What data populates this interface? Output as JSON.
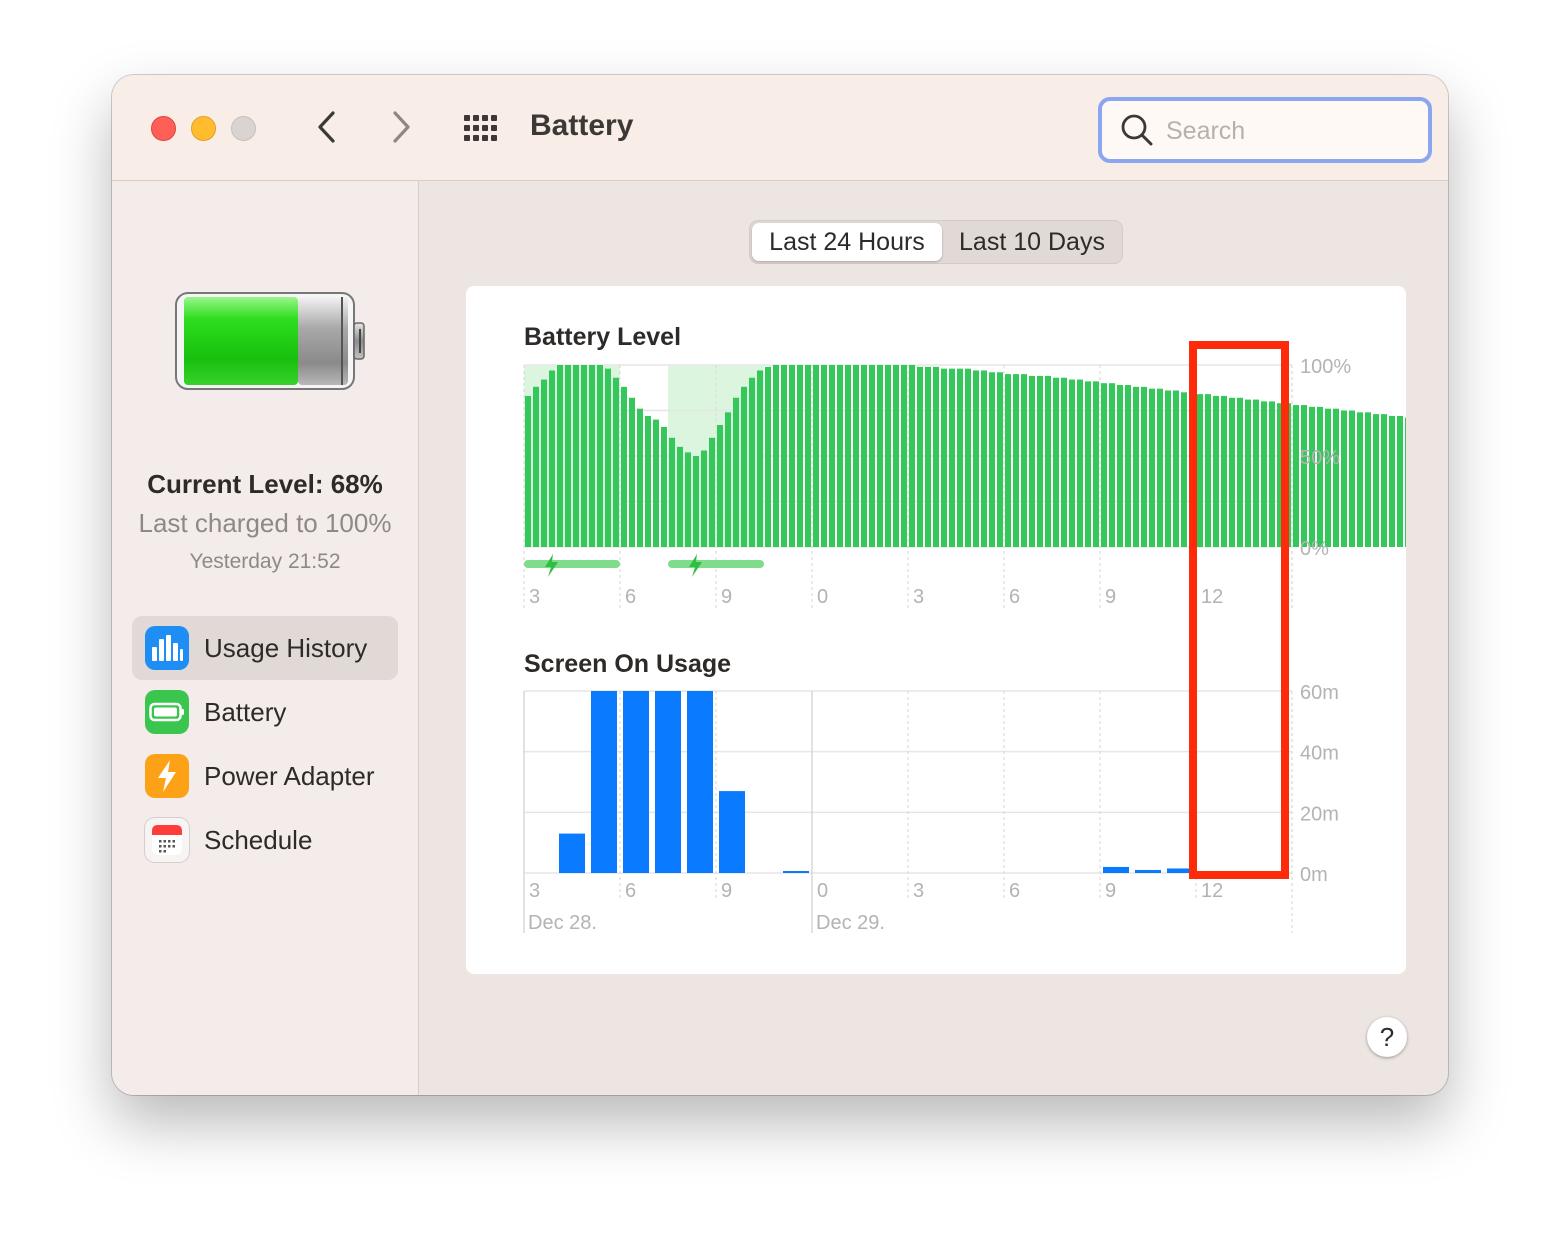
{
  "window": {
    "title": "Battery",
    "search": {
      "placeholder": "Search",
      "value": ""
    }
  },
  "sidebar": {
    "current_level": "Current Level: 68%",
    "last_charged": "Last charged to 100%",
    "charge_time": "Yesterday 21:52",
    "items": [
      {
        "label": "Usage History",
        "icon": "bar-chart-icon",
        "selected": true
      },
      {
        "label": "Battery",
        "icon": "battery-icon",
        "selected": false
      },
      {
        "label": "Power Adapter",
        "icon": "lightning-icon",
        "selected": false
      },
      {
        "label": "Schedule",
        "icon": "calendar-icon",
        "selected": false
      }
    ]
  },
  "main": {
    "segments": [
      {
        "label": "Last 24 Hours",
        "selected": true
      },
      {
        "label": "Last 10 Days",
        "selected": false
      }
    ],
    "help_label": "?"
  },
  "colors": {
    "battery_bar": "#34c759",
    "charging_band": "#dcf5de",
    "screen_bar": "#0a7aff",
    "highlight_box": "#ff2a0a"
  },
  "chart_data": [
    {
      "type": "bar",
      "title": "Battery Level",
      "x_tick_labels": [
        "3",
        "6",
        "9",
        "0",
        "3",
        "6",
        "9",
        "12"
      ],
      "y_tick_labels": [
        "100%",
        "50%",
        "0%"
      ],
      "ylim": [
        0,
        100
      ],
      "interval_hours": 0.25,
      "start_hour": 3,
      "values": [
        83,
        88,
        92,
        97,
        100,
        100,
        100,
        100,
        100,
        100,
        98,
        93,
        88,
        82,
        76,
        72,
        70,
        66,
        60,
        55,
        52,
        50,
        53,
        60,
        67,
        74,
        82,
        88,
        93,
        97,
        99,
        100,
        100,
        100,
        100,
        100,
        100,
        100,
        100,
        100,
        100,
        100,
        100,
        100,
        100,
        100,
        100,
        100,
        100,
        99,
        99,
        99,
        98,
        98,
        98,
        98,
        97,
        97,
        96,
        96,
        95,
        95,
        95,
        94,
        94,
        94,
        93,
        93,
        92,
        92,
        91,
        91,
        90,
        90,
        89,
        89,
        88,
        88,
        87,
        87,
        86,
        86,
        85,
        85,
        84,
        84,
        83,
        83,
        82,
        82,
        81,
        81,
        80,
        80,
        79,
        79,
        78,
        78,
        77,
        77,
        76,
        76,
        75,
        75,
        74,
        74,
        73,
        73,
        72,
        72,
        71,
        71,
        70,
        70,
        69,
        68
      ],
      "charging_periods": [
        {
          "start_hour": 3,
          "end_hour": 6
        },
        {
          "start_hour": 7.5,
          "end_hour": 10.5
        }
      ]
    },
    {
      "type": "bar",
      "title": "Screen On Usage",
      "x_tick_labels": [
        "3",
        "6",
        "9",
        "0",
        "3",
        "6",
        "9",
        "12"
      ],
      "date_labels": [
        "Dec 28.",
        "Dec 29."
      ],
      "y_tick_labels": [
        "60m",
        "40m",
        "20m",
        "0m"
      ],
      "ylim": [
        0,
        60
      ],
      "interval_hours": 1,
      "categories_hours": [
        3,
        4,
        5,
        6,
        7,
        8,
        9,
        10,
        11,
        12,
        13,
        14,
        15,
        16,
        17,
        18,
        19,
        20,
        21,
        22,
        23,
        24,
        25,
        26
      ],
      "values": [
        0,
        13,
        60,
        60,
        60,
        60,
        27,
        0,
        0.5,
        0,
        0,
        0,
        0,
        0,
        0,
        0,
        0,
        0,
        2,
        1,
        1.5,
        0.3,
        0,
        0
      ]
    }
  ]
}
